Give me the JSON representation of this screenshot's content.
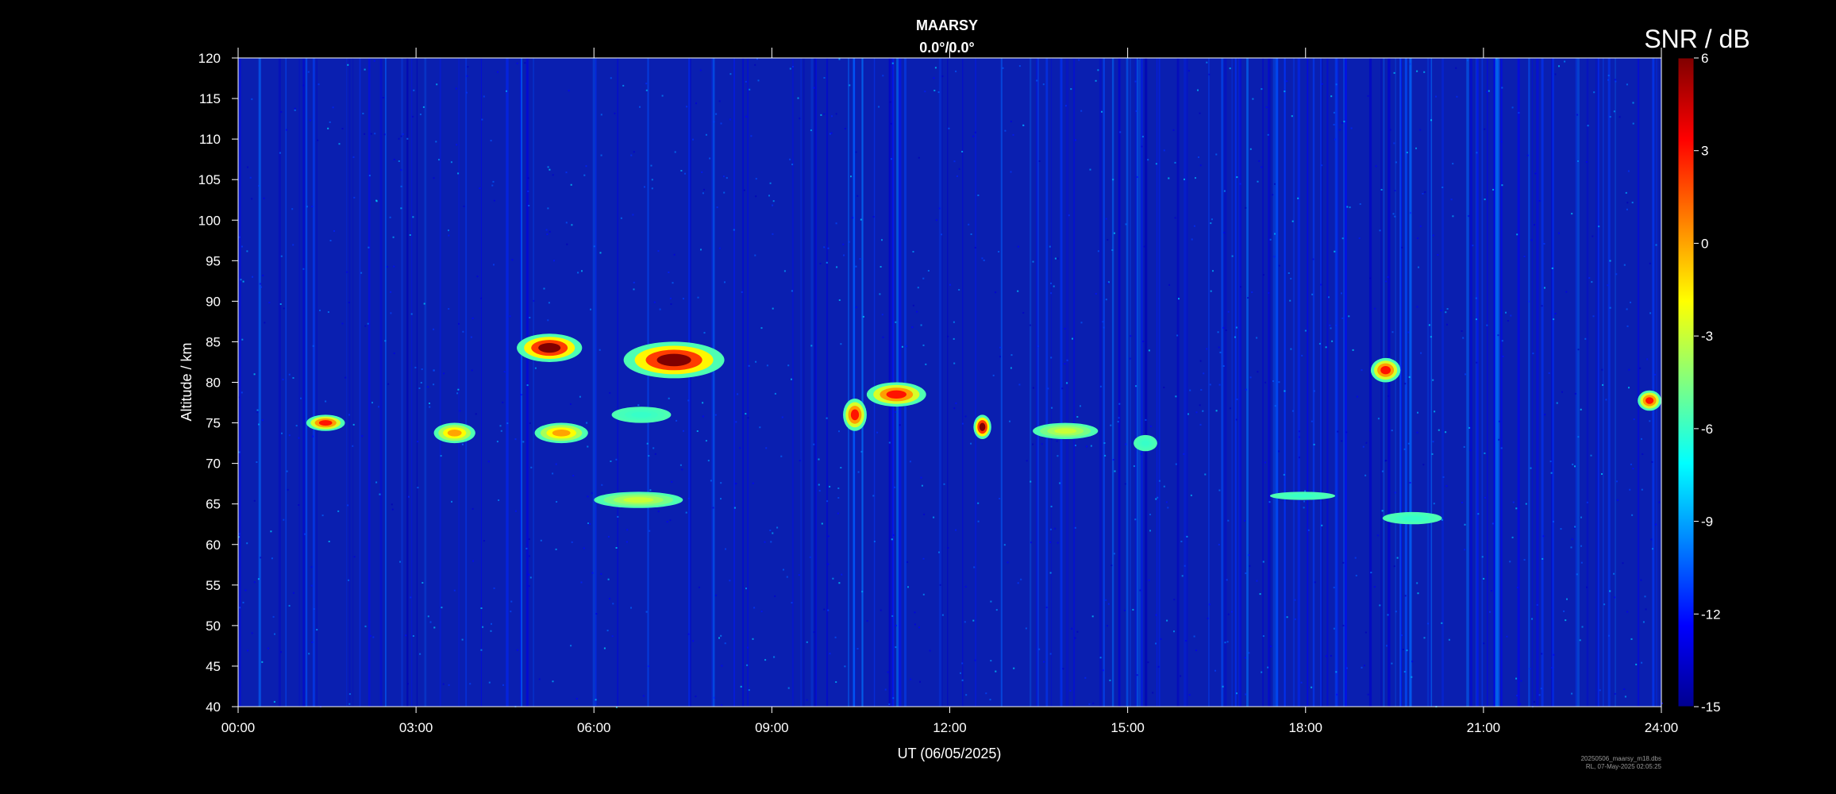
{
  "chart_data": {
    "type": "heatmap",
    "title": "MAARSY",
    "subtitle": "0.0°/0.0°",
    "xlabel": "UT (06/05/2025)",
    "ylabel": "Altitude / km",
    "xlim": [
      0,
      24
    ],
    "ylim": [
      40,
      120
    ],
    "x_ticks": [
      "00:00",
      "03:00",
      "06:00",
      "09:00",
      "12:00",
      "15:00",
      "18:00",
      "21:00",
      "24:00"
    ],
    "y_ticks": [
      40,
      45,
      50,
      55,
      60,
      65,
      70,
      75,
      80,
      85,
      90,
      95,
      100,
      105,
      110,
      115,
      120
    ],
    "colorbar": {
      "label": "SNR / dB",
      "min": -15,
      "max": 6,
      "ticks": [
        6,
        3,
        0,
        -3,
        -6,
        -9,
        -12,
        -15
      ],
      "colormap": "jet"
    },
    "background_snr_db": -13,
    "echo_features": [
      {
        "t_start": 1.15,
        "t_end": 1.8,
        "alt_low": 74,
        "alt_high": 76,
        "peak_snr_db": 3
      },
      {
        "t_start": 3.3,
        "t_end": 4.0,
        "alt_low": 72.5,
        "alt_high": 75,
        "peak_snr_db": 0
      },
      {
        "t_start": 4.7,
        "t_end": 5.8,
        "alt_low": 82.5,
        "alt_high": 86,
        "peak_snr_db": 6
      },
      {
        "t_start": 5.0,
        "t_end": 5.9,
        "alt_low": 72.5,
        "alt_high": 75,
        "peak_snr_db": 0
      },
      {
        "t_start": 6.5,
        "t_end": 8.2,
        "alt_low": 80.5,
        "alt_high": 85,
        "peak_snr_db": 6
      },
      {
        "t_start": 6.3,
        "t_end": 7.3,
        "alt_low": 75,
        "alt_high": 77,
        "peak_snr_db": -6
      },
      {
        "t_start": 6.0,
        "t_end": 7.5,
        "alt_low": 64.5,
        "alt_high": 66.5,
        "peak_snr_db": -3
      },
      {
        "t_start": 10.2,
        "t_end": 10.6,
        "alt_low": 74,
        "alt_high": 78,
        "peak_snr_db": 3
      },
      {
        "t_start": 10.6,
        "t_end": 11.6,
        "alt_low": 77,
        "alt_high": 80,
        "peak_snr_db": 3
      },
      {
        "t_start": 12.4,
        "t_end": 12.7,
        "alt_low": 73,
        "alt_high": 76,
        "peak_snr_db": 6
      },
      {
        "t_start": 13.4,
        "t_end": 14.5,
        "alt_low": 73,
        "alt_high": 75,
        "peak_snr_db": -3
      },
      {
        "t_start": 15.1,
        "t_end": 15.5,
        "alt_low": 71.5,
        "alt_high": 73.5,
        "peak_snr_db": -6
      },
      {
        "t_start": 19.1,
        "t_end": 19.6,
        "alt_low": 80,
        "alt_high": 83,
        "peak_snr_db": 3
      },
      {
        "t_start": 19.3,
        "t_end": 20.3,
        "alt_low": 62.5,
        "alt_high": 64,
        "peak_snr_db": -6
      },
      {
        "t_start": 17.4,
        "t_end": 18.5,
        "alt_low": 65.5,
        "alt_high": 66.5,
        "peak_snr_db": -6
      },
      {
        "t_start": 23.6,
        "t_end": 24.0,
        "alt_low": 76.5,
        "alt_high": 79,
        "peak_snr_db": 3
      }
    ]
  },
  "footer": {
    "filename": "20250506_maarsy_m18.dbs",
    "stamp": "RL, 07-May-2025 02:05:25"
  }
}
